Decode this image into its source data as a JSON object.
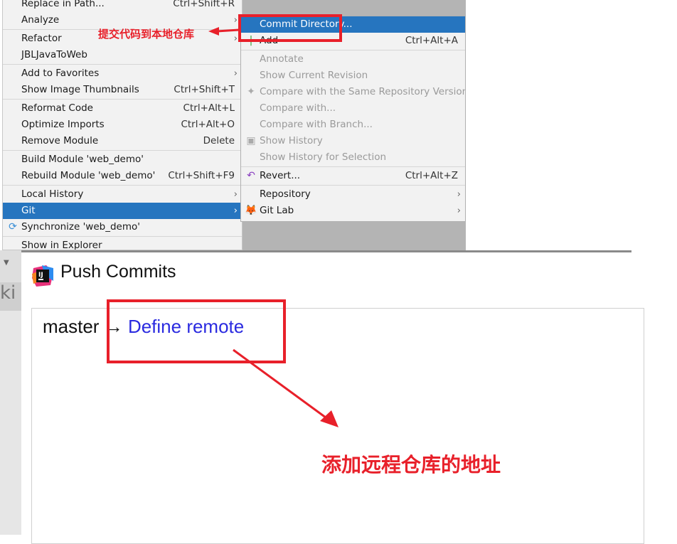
{
  "left_menu": {
    "items": [
      {
        "label": "Replace in Path...",
        "shortcut": "Ctrl+Shift+R"
      },
      {
        "label": "Analyze",
        "arrow": true
      },
      {
        "sep": true
      },
      {
        "label": "Refactor",
        "arrow": true
      },
      {
        "label": "JBLJavaToWeb"
      },
      {
        "sep": true
      },
      {
        "label": "Add to Favorites",
        "arrow": true
      },
      {
        "label": "Show Image Thumbnails",
        "shortcut": "Ctrl+Shift+T"
      },
      {
        "sep": true
      },
      {
        "label": "Reformat Code",
        "shortcut": "Ctrl+Alt+L"
      },
      {
        "label": "Optimize Imports",
        "shortcut": "Ctrl+Alt+O"
      },
      {
        "label": "Remove Module",
        "shortcut": "Delete"
      },
      {
        "sep": true
      },
      {
        "label": "Build Module 'web_demo'"
      },
      {
        "label": "Rebuild Module 'web_demo'",
        "shortcut": "Ctrl+Shift+F9"
      },
      {
        "sep": true
      },
      {
        "label": "Local History",
        "arrow": true
      },
      {
        "label": "Git",
        "arrow": true,
        "selected": true
      },
      {
        "label": "Synchronize 'web_demo'",
        "icon": "sync-icon"
      },
      {
        "sep": true
      },
      {
        "label": "Show in Explorer"
      }
    ]
  },
  "git_submenu": {
    "items": [
      {
        "label": "Commit Directory...",
        "selected": true
      },
      {
        "label": "Add",
        "shortcut": "Ctrl+Alt+A",
        "icon": "add-icon"
      },
      {
        "sep": true
      },
      {
        "label": "Annotate",
        "disabled": true
      },
      {
        "label": "Show Current Revision",
        "disabled": true
      },
      {
        "label": "Compare with the Same Repository Version",
        "disabled": true,
        "icon": "compare-icon"
      },
      {
        "label": "Compare with...",
        "disabled": true
      },
      {
        "label": "Compare with Branch...",
        "disabled": true
      },
      {
        "label": "Show History",
        "disabled": true,
        "icon": "history-icon"
      },
      {
        "label": "Show History for Selection",
        "disabled": true
      },
      {
        "sep": true
      },
      {
        "label": "Revert...",
        "shortcut": "Ctrl+Alt+Z",
        "icon": "revert-icon"
      },
      {
        "sep": true
      },
      {
        "label": "Repository",
        "arrow": true
      },
      {
        "label": "Git Lab",
        "arrow": true,
        "icon": "gitlab-icon"
      }
    ]
  },
  "background": {
    "partial_text": "ki"
  },
  "dialog": {
    "title": "Push Commits",
    "branch": "master",
    "arrow": "→",
    "remote_link": "Define remote"
  },
  "annotations": {
    "commit_note": "提交代码到本地仓库",
    "remote_note": "添加远程仓库的地址",
    "color": "#e8202a"
  },
  "colors": {
    "selection": "#2675bf",
    "link": "#2a2ae0"
  }
}
